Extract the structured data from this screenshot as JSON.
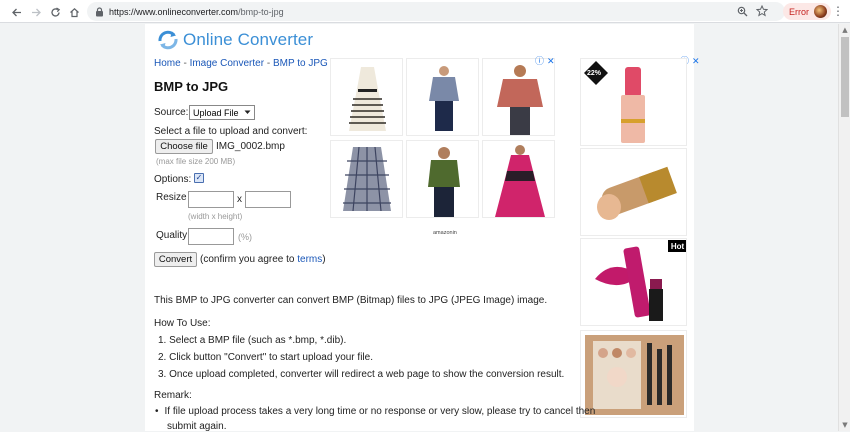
{
  "browser": {
    "url_host": "https://www.onlineconverter.com",
    "url_path": "/bmp-to-jpg",
    "error_label": "Error"
  },
  "site": {
    "logo_text": "Online Converter",
    "brand_color": "#3b8fd6"
  },
  "breadcrumb": {
    "items": [
      "Home",
      "Image Converter",
      "BMP to JPG"
    ],
    "separator": " - "
  },
  "page_title": "BMP to JPG",
  "form": {
    "source_label": "Source:",
    "source_value": "Upload File",
    "select_prompt": "Select a file to upload and convert:",
    "choose_file_label": "Choose file",
    "chosen_file": "IMG_0002.bmp",
    "max_size_note": "(max file size 200 MB)",
    "options_label": "Options:",
    "resize_label": "Resize",
    "resize_x": "x",
    "resize_hint": "(width x height)",
    "quality_label": "Quality",
    "quality_unit": "(%)",
    "convert_label": "Convert",
    "confirm_prefix": "(confirm you agree to ",
    "terms_label": "terms",
    "confirm_suffix": ")"
  },
  "ads": {
    "amazon_label": "amazonin",
    "discount_badge": "22%",
    "hot_badge": "Hot"
  },
  "content": {
    "description": "This BMP to JPG converter can convert BMP (Bitmap) files to JPG (JPEG Image) image.",
    "how_to_title": "How To Use:",
    "steps": [
      "1. Select a BMP file (such as *.bmp, *.dib).",
      "2. Click button \"Convert\" to start upload your file.",
      "3. Once upload completed, converter will redirect a web page to show the conversion result."
    ],
    "remark_title": "Remark:",
    "remarks": [
      "If file upload process takes a very long time or no response or very slow, please try to cancel then",
      "submit again."
    ]
  }
}
